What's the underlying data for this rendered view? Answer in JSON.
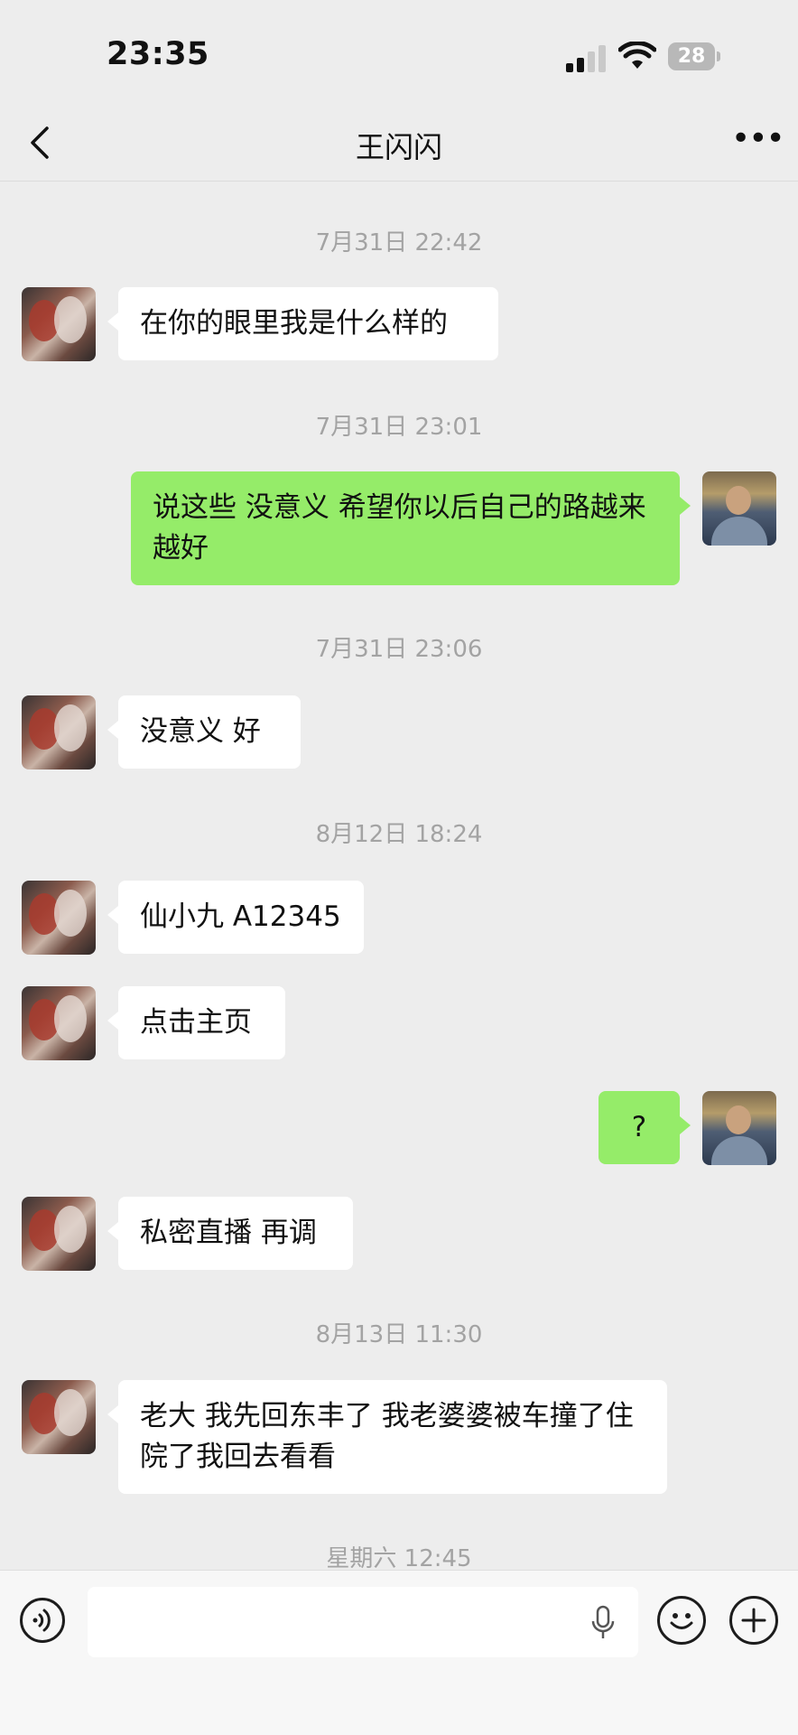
{
  "status": {
    "time": "23:35",
    "battery": "28"
  },
  "nav": {
    "title": "王闪闪"
  },
  "timestamps": [
    "7月31日 22:42",
    "7月31日 23:01",
    "7月31日 23:06",
    "8月12日 18:24",
    "8月13日 11:30",
    "星期六 12:45"
  ],
  "messages": [
    {
      "side": "left",
      "text": "在你的眼里我是什么样的"
    },
    {
      "side": "right",
      "text": "说这些 没意义 希望你以后自己的路越来越好"
    },
    {
      "side": "left",
      "text": "没意义 好"
    },
    {
      "side": "left",
      "text": "仙小九 A12345"
    },
    {
      "side": "left",
      "text": "点击主页"
    },
    {
      "side": "right",
      "text": "?"
    },
    {
      "side": "left",
      "text": "私密直播 再调"
    },
    {
      "side": "left",
      "text": "老大 我先回东丰了 我老婆婆被车撞了住院了我回去看看"
    }
  ],
  "input": {
    "value": ""
  },
  "colors": {
    "background": "#ededed",
    "incoming": "#ffffff",
    "outgoing": "#95ec69",
    "timestamp": "#a3a3a3"
  },
  "icons": [
    "back-chevron-icon",
    "more-icon",
    "voice-icon",
    "microphone-icon",
    "emoji-icon",
    "plus-icon"
  ]
}
